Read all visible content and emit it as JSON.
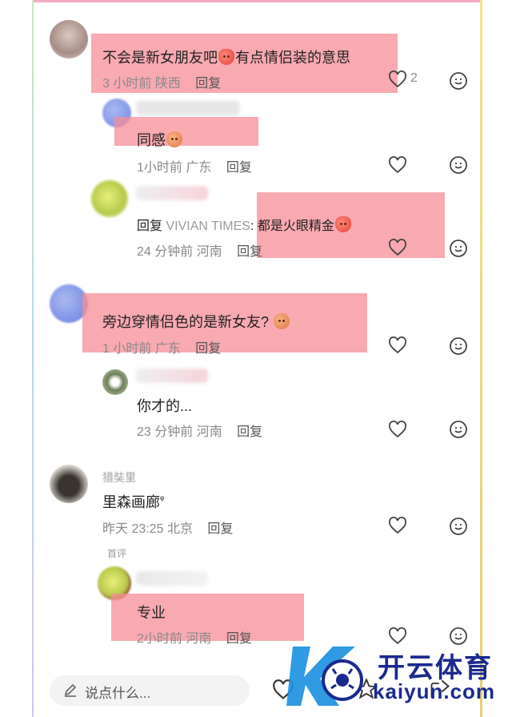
{
  "comments": [
    {
      "text_before": "不会是新女朋友吧",
      "text_after": "有点情侣装的意思",
      "time": "3 小时前",
      "location": "陕西",
      "reply_label": "回复",
      "likes": "2"
    },
    {
      "text": "同感",
      "time": "1小时前",
      "location": "广东",
      "reply_label": "回复"
    },
    {
      "reply_prefix": "回复",
      "reply_to": "VIVIAN TIMES",
      "text": ": 都是火眼精金",
      "time": "24 分钟前",
      "location": "河南",
      "reply_label": "回复"
    },
    {
      "text": "旁边穿情侣色的是新女友?",
      "time": "1 小时前",
      "location": "广东",
      "reply_label": "回复"
    },
    {
      "text": "你才的...",
      "time": "23 分钟前",
      "location": "河南",
      "reply_label": "回复"
    },
    {
      "username": "猎奘里",
      "text": "里森画廊",
      "text_suffix": "ᵠ",
      "time": "昨天 23:25",
      "location": "北京",
      "reply_label": "回复",
      "tag": "首评"
    },
    {
      "text": "专业",
      "time": "2小时前",
      "location": "河南",
      "reply_label": "回复"
    }
  ],
  "input": {
    "placeholder": "说点什么..."
  },
  "watermark": {
    "title": "开云体育",
    "url": "kaiyun.com"
  },
  "colors": {
    "highlight": "#f78c96",
    "meta": "#8a8a8a",
    "watermark": "#1a2a8f"
  },
  "icons": [
    "heart-icon",
    "smile-icon",
    "pen-icon",
    "star-icon",
    "share-icon"
  ]
}
